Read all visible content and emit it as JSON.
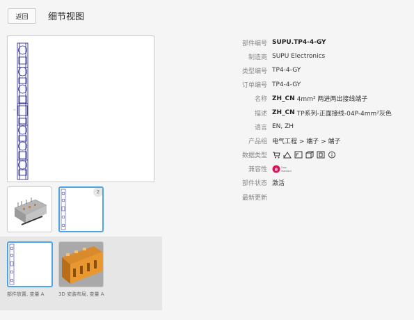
{
  "header": {
    "back_label": "返回",
    "title": "细节视图"
  },
  "thumbnails": {
    "badge_count": "2"
  },
  "variants": [
    {
      "caption": "部件放置, 变量 A"
    },
    {
      "caption": "3D 安装布局, 变量 A"
    }
  ],
  "properties": [
    {
      "label": "部件编号",
      "value": "SUPU.TP4-4-GY",
      "prefix": ""
    },
    {
      "label": "制造商",
      "value": "SUPU Electronics",
      "prefix": ""
    },
    {
      "label": "类型编号",
      "value": "TP4-4-GY",
      "prefix": ""
    },
    {
      "label": "订单编号",
      "value": "TP4-4-GY",
      "prefix": ""
    },
    {
      "label": "名称",
      "value": "4mm² 两进两出接线端子",
      "prefix": "ZH_CN"
    },
    {
      "label": "描述",
      "value": "TP系列-正面接线-04P-4mm²灰色",
      "prefix": "ZH_CN"
    },
    {
      "label": "语言",
      "value": "EN, ZH",
      "prefix": ""
    },
    {
      "label": "产品组",
      "value": "电气工程 > 端子 > 端子",
      "prefix": ""
    },
    {
      "label": "数据类型",
      "value": "",
      "prefix": ""
    },
    {
      "label": "兼容性",
      "value": "",
      "prefix": ""
    },
    {
      "label": "部件状态",
      "value": "激活",
      "prefix": ""
    },
    {
      "label": "最新更新",
      "value": "",
      "prefix": ""
    }
  ],
  "compat_logo": {
    "letter": "e",
    "text_line1": "Data",
    "text_line2": "Standard",
    "color": "#d4145a"
  },
  "data_type_icons": [
    "cart-icon",
    "schematic-icon",
    "macro-icon",
    "3d-icon",
    "graphic-icon",
    "info-icon"
  ],
  "colors": {
    "accent": "#4aa6e8",
    "drawing": "#1a1a8c"
  }
}
